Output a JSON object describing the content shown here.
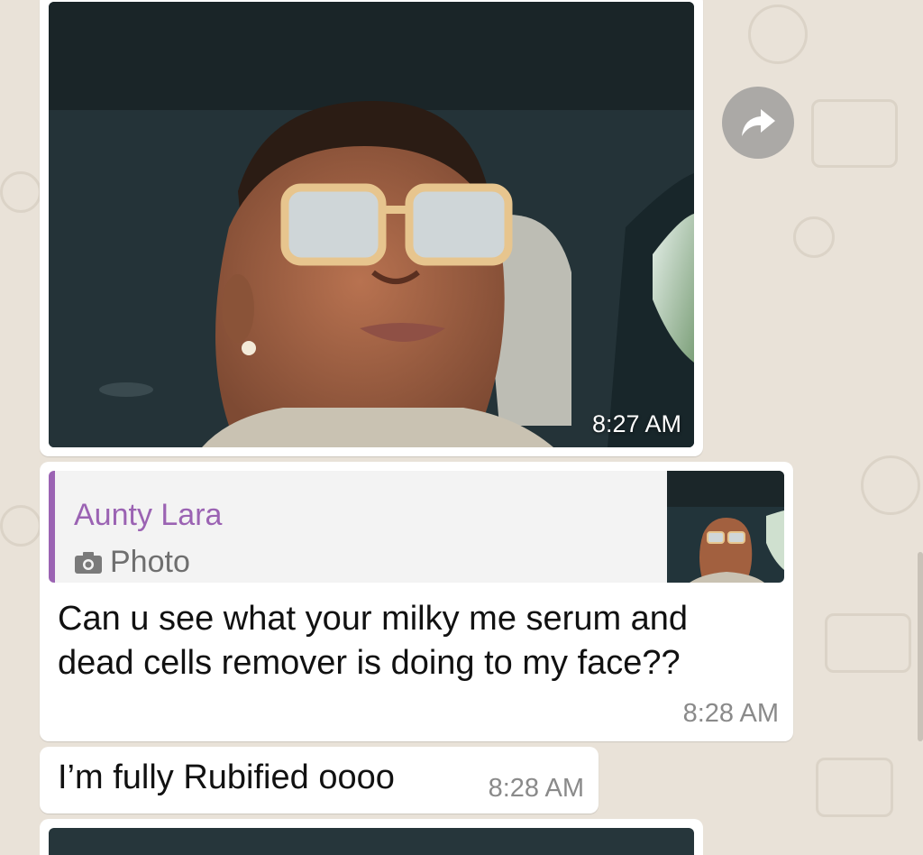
{
  "photo_message": {
    "time": "8:27 AM"
  },
  "reply_message": {
    "quoted_sender": "Aunty Lara",
    "quoted_type": "Photo",
    "text_line1": "Can u see what your milky me serum and",
    "text_line2": "dead cells remover is doing to my face??",
    "time": "8:28 AM"
  },
  "text_message": {
    "text": "I’m fully Rubified oooo",
    "time": "8:28 AM"
  },
  "icons": {
    "forward": "forward-arrow-icon",
    "camera": "camera-icon"
  },
  "colors": {
    "quote_accent": "#9b63b3",
    "wallpaper": "#e9e2d8",
    "bubble": "#ffffff"
  }
}
